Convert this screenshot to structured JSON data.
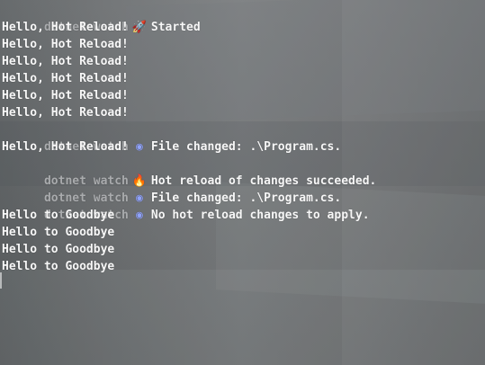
{
  "terminal": {
    "lines": [
      {
        "prefix": "dotnet watch",
        "icon": "rocket-icon",
        "icon_glyph": "🚀",
        "text": "Started"
      },
      {
        "text": "Hello, Hot Reload!"
      },
      {
        "text": "Hello, Hot Reload!"
      },
      {
        "text": "Hello, Hot Reload!"
      },
      {
        "text": "Hello, Hot Reload!"
      },
      {
        "text": "Hello, Hot Reload!"
      },
      {
        "text": "Hello, Hot Reload!"
      },
      {
        "prefix": "dotnet watch",
        "icon": "sync-icon",
        "icon_glyph": "◉",
        "text": "File changed: .\\Program.cs."
      },
      {
        "text": "Hello, Hot Reload!"
      },
      {
        "prefix": "dotnet watch",
        "icon": "fire-icon",
        "icon_glyph": "🔥",
        "text": "Hot reload of changes succeeded."
      },
      {
        "prefix": "dotnet watch",
        "icon": "sync-icon",
        "icon_glyph": "◉",
        "text": "File changed: .\\Program.cs."
      },
      {
        "prefix": "dotnet watch",
        "icon": "sync-icon",
        "icon_glyph": "◉",
        "text": "No hot reload changes to apply."
      },
      {
        "text": "Hello to Goodbye"
      },
      {
        "text": "Hello to Goodbye"
      },
      {
        "text": "Hello to Goodbye"
      },
      {
        "text": "Hello to Goodbye"
      }
    ]
  }
}
